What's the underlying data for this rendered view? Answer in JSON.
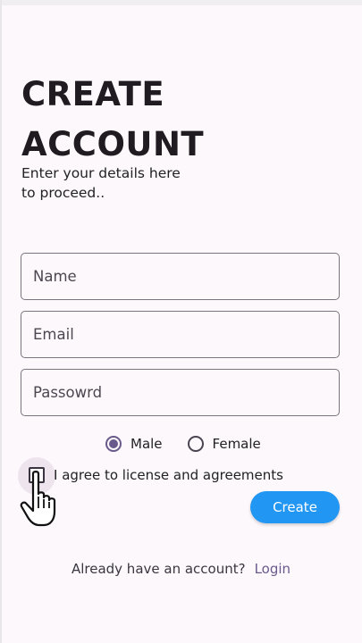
{
  "header": {
    "title": "CREATE ACCOUNT",
    "subtitle": "Enter your details here to proceed.."
  },
  "form": {
    "name_placeholder": "Name",
    "email_placeholder": "Email",
    "password_placeholder": "Passowrd",
    "gender": {
      "options": [
        "Male",
        "Female"
      ],
      "selected": "Male"
    },
    "agreement_label": "I agree to license and agreements",
    "agreement_checked": false,
    "create_label": "Create"
  },
  "footer": {
    "prompt": "Already have an account?",
    "login_label": "Login"
  },
  "colors": {
    "background": "#fcf8fc",
    "accent": "#6a5a8c",
    "primary_button": "#2196f3"
  },
  "icons": [
    "hand-pointer-cursor-icon"
  ]
}
